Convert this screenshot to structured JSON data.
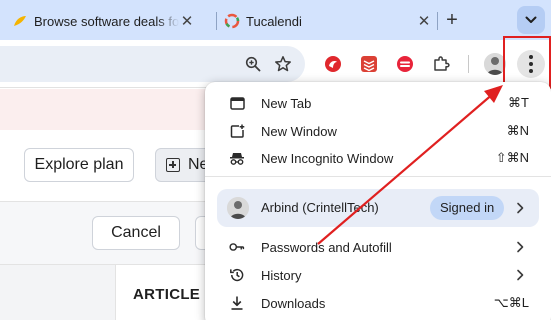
{
  "browser": {
    "tabs": [
      {
        "title": "Browse software deals for",
        "favicon": "appsumo-icon",
        "close_label": "✕"
      },
      {
        "title": "Tucalendi",
        "favicon": "tucalendi-icon",
        "close_label": "✕"
      }
    ],
    "new_tab_label": "+",
    "tab_search_icon": "chevron-down-icon",
    "toolbar_icons": [
      "zoom-icon",
      "bookmark-star-icon",
      "extension-red-circle-icon",
      "todoist-icon",
      "extension-red-icon",
      "extensions-puzzle-icon"
    ],
    "menu_button_icon": "three-dots-vertical-icon"
  },
  "page": {
    "buttons": {
      "explore": "Explore plan",
      "new": "Ne",
      "cancel": "Cancel"
    },
    "article_heading": "ARTICLE I"
  },
  "menu": {
    "items_top": [
      {
        "label": "New Tab",
        "shortcut": "⌘T",
        "icon": "new-tab-icon"
      },
      {
        "label": "New Window",
        "shortcut": "⌘N",
        "icon": "new-window-icon"
      },
      {
        "label": "New Incognito Window",
        "shortcut": "⇧⌘N",
        "icon": "incognito-icon"
      }
    ],
    "profile": {
      "name": "Arbind (CrintellTech)",
      "status": "Signed in"
    },
    "items_bottom": [
      {
        "label": "Passwords and Autofill",
        "icon": "key-icon"
      },
      {
        "label": "History",
        "icon": "history-icon"
      },
      {
        "label": "Downloads",
        "shortcut": "⌥⌘L",
        "icon": "download-icon"
      }
    ]
  },
  "colors": {
    "tab_strip": "#d3e3fd",
    "annotation": "#e02020",
    "banner": "#fbeeee",
    "profile_bg": "#e8edf7",
    "signed_in_pill": "#c2d7f7"
  }
}
